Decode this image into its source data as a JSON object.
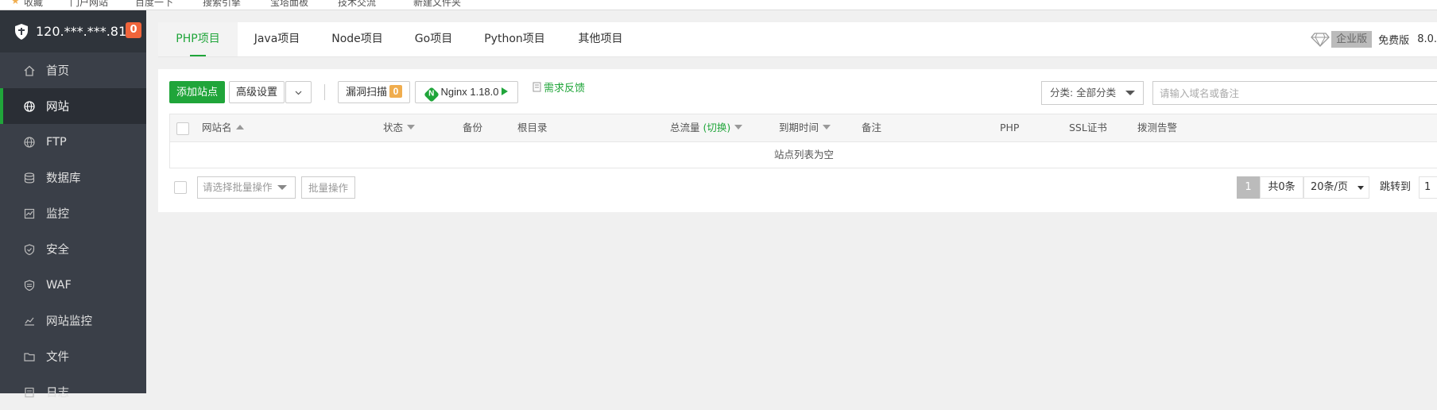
{
  "bookmarks": [
    "收藏",
    "门户网站",
    "百度一下",
    "搜索引擎",
    "宝塔面板",
    "技术交流",
    "新建文件夹"
  ],
  "sidebar": {
    "server_ip": "120.***.***.81",
    "notification_count": "0",
    "items": [
      {
        "label": "首页",
        "icon": "home-icon"
      },
      {
        "label": "网站",
        "icon": "globe-icon"
      },
      {
        "label": "FTP",
        "icon": "ftp-globe-icon"
      },
      {
        "label": "数据库",
        "icon": "database-icon"
      },
      {
        "label": "监控",
        "icon": "monitor-icon"
      },
      {
        "label": "安全",
        "icon": "shield-check-icon"
      },
      {
        "label": "WAF",
        "icon": "waf-shield-icon"
      },
      {
        "label": "网站监控",
        "icon": "chart-line-icon"
      },
      {
        "label": "文件",
        "icon": "folder-icon"
      },
      {
        "label": "日志",
        "icon": "log-icon"
      }
    ],
    "active_item": "网站"
  },
  "tabs": [
    "PHP项目",
    "Java项目",
    "Node项目",
    "Go项目",
    "Python项目",
    "其他项目"
  ],
  "active_tab": "PHP项目",
  "edition": {
    "enterprise_label": "企业版",
    "free_label": "免费版",
    "version": "8.0."
  },
  "toolbar": {
    "add_site": "添加站点",
    "advanced_settings": "高级设置",
    "vuln_scan": "漏洞扫描",
    "vuln_count": "0",
    "nginx_version": "Nginx 1.18.0",
    "feedback": "需求反馈",
    "category_select": "分类: 全部分类",
    "search_placeholder": "请输入域名或备注"
  },
  "table": {
    "columns": {
      "site_name": "网站名",
      "status": "状态",
      "backup": "备份",
      "root_dir": "根目录",
      "traffic": "总流量",
      "traffic_toggle": "(切换)",
      "expire": "到期时间",
      "note": "备注",
      "php": "PHP",
      "ssl": "SSL证书",
      "alert": "拨测告警"
    },
    "empty_text": "站点列表为空"
  },
  "footer": {
    "batch_placeholder": "请选择批量操作",
    "batch_button": "批量操作"
  },
  "pagination": {
    "current_page": "1",
    "total": "共0条",
    "page_size": "20条/页",
    "jump_label": "跳转到",
    "jump_value": "1"
  },
  "colors": {
    "accent": "#20a53a",
    "sidebar_bg": "#3a3f48",
    "badge": "#f0643b",
    "vuln_badge": "#f0ad4e"
  }
}
